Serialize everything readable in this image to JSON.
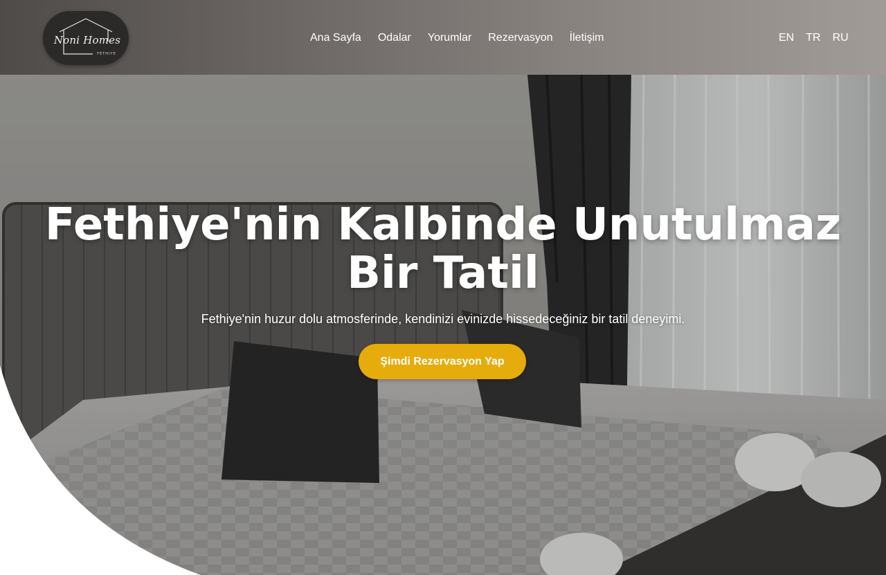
{
  "header": {
    "logo": {
      "brand_script": "Noni Homes",
      "location": "FETHIYE"
    },
    "nav": [
      {
        "label": "Ana Sayfa"
      },
      {
        "label": "Odalar"
      },
      {
        "label": "Yorumlar"
      },
      {
        "label": "Rezervasyon"
      },
      {
        "label": "İletişim"
      }
    ],
    "languages": [
      "EN",
      "TR",
      "RU"
    ]
  },
  "hero": {
    "title_line1": "Fethiye'nin Kalbinde Unutulmaz",
    "title_line2": "Bir Tatil",
    "subtitle": "Fethiye'nin huzur dolu atmosferinde, kendinizi evinizde hissedeceğiniz bir tatil deneyimi.",
    "cta_label": "Şimdi Rezervasyon Yap",
    "background": "bedroom-photo"
  },
  "colors": {
    "accent": "#e6ac0c",
    "header_dark": "#4f4b49",
    "header_light": "#a19b97",
    "text_light": "#ffffff"
  }
}
